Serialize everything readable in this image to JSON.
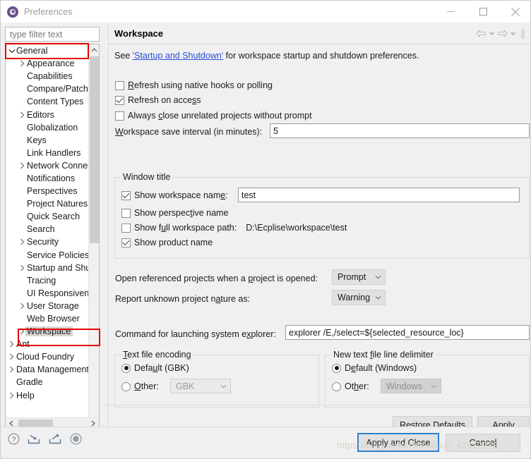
{
  "window": {
    "title": "Preferences",
    "icon": "preferences-gear-icon",
    "minimize_label": "Minimize",
    "maximize_label": "Maximize",
    "close_label": "Close"
  },
  "sidebar": {
    "filter": {
      "value": "",
      "placeholder": "type filter text"
    },
    "items": [
      {
        "label": "General",
        "indent": 0,
        "expander": "down",
        "selected": false,
        "highlighted": true
      },
      {
        "label": "Appearance",
        "indent": 1,
        "expander": "right",
        "selected": false
      },
      {
        "label": "Capabilities",
        "indent": 1,
        "expander": "none",
        "selected": false
      },
      {
        "label": "Compare/Patch",
        "indent": 1,
        "expander": "none",
        "selected": false
      },
      {
        "label": "Content Types",
        "indent": 1,
        "expander": "none",
        "selected": false
      },
      {
        "label": "Editors",
        "indent": 1,
        "expander": "right",
        "selected": false
      },
      {
        "label": "Globalization",
        "indent": 1,
        "expander": "none",
        "selected": false
      },
      {
        "label": "Keys",
        "indent": 1,
        "expander": "none",
        "selected": false
      },
      {
        "label": "Link Handlers",
        "indent": 1,
        "expander": "none",
        "selected": false
      },
      {
        "label": "Network Connections",
        "indent": 1,
        "expander": "right",
        "selected": false
      },
      {
        "label": "Notifications",
        "indent": 1,
        "expander": "none",
        "selected": false
      },
      {
        "label": "Perspectives",
        "indent": 1,
        "expander": "none",
        "selected": false
      },
      {
        "label": "Project Natures",
        "indent": 1,
        "expander": "none",
        "selected": false
      },
      {
        "label": "Quick Search",
        "indent": 1,
        "expander": "none",
        "selected": false
      },
      {
        "label": "Search",
        "indent": 1,
        "expander": "none",
        "selected": false
      },
      {
        "label": "Security",
        "indent": 1,
        "expander": "right",
        "selected": false
      },
      {
        "label": "Service Policies",
        "indent": 1,
        "expander": "none",
        "selected": false
      },
      {
        "label": "Startup and Shutdown",
        "indent": 1,
        "expander": "right",
        "selected": false
      },
      {
        "label": "Tracing",
        "indent": 1,
        "expander": "none",
        "selected": false
      },
      {
        "label": "UI Responsiveness",
        "indent": 1,
        "expander": "none",
        "selected": false
      },
      {
        "label": "User Storage",
        "indent": 1,
        "expander": "right",
        "selected": false
      },
      {
        "label": "Web Browser",
        "indent": 1,
        "expander": "none",
        "selected": false
      },
      {
        "label": "Workspace",
        "indent": 1,
        "expander": "right",
        "selected": true,
        "highlighted": true
      },
      {
        "label": "Ant",
        "indent": 0,
        "expander": "right",
        "selected": false
      },
      {
        "label": "Cloud Foundry",
        "indent": 0,
        "expander": "right",
        "selected": false
      },
      {
        "label": "Data Management",
        "indent": 0,
        "expander": "right",
        "selected": false
      },
      {
        "label": "Gradle",
        "indent": 0,
        "expander": "none",
        "selected": false
      },
      {
        "label": "Help",
        "indent": 0,
        "expander": "right",
        "selected": false
      }
    ]
  },
  "page": {
    "title": "Workspace",
    "toolbar": {
      "back": "back-arrow",
      "back_menu": "back-dropdown",
      "forward": "forward-arrow",
      "forward_menu": "forward-dropdown",
      "more": "view-menu"
    },
    "intro": {
      "prefix": "See ",
      "link": "'Startup and Shutdown'",
      "suffix": " for workspace startup and shutdown preferences."
    },
    "checkboxes": [
      {
        "label": "Refresh using native hooks or polling",
        "checked": false,
        "mnemonic": "R"
      },
      {
        "label": "Refresh on access",
        "checked": true,
        "mnemonic": "s"
      },
      {
        "label": "Always close unrelated projects without prompt",
        "checked": false,
        "mnemonic": "c"
      }
    ],
    "save_interval": {
      "label": "Workspace save interval (in minutes):",
      "value": "5"
    },
    "window_title_group": {
      "title": "Window title",
      "show_workspace_name": {
        "label": "Show workspace name:",
        "checked": true,
        "value": "test"
      },
      "show_perspective_name": {
        "label": "Show perspective name",
        "checked": false
      },
      "show_full_workspace_path": {
        "label": "Show full workspace path:",
        "checked": false,
        "value": "D:\\Ecplise\\workspace\\test"
      },
      "show_product_name": {
        "label": "Show product name",
        "checked": true
      }
    },
    "open_referenced": {
      "label": "Open referenced projects when a project is opened:",
      "value": "Prompt"
    },
    "report_nature": {
      "label": "Report unknown project nature as:",
      "value": "Warning"
    },
    "explorer_command": {
      "label": "Command for launching system explorer:",
      "value": "explorer /E,/select=${selected_resource_loc}"
    },
    "text_file_encoding": {
      "title": "Text file encoding",
      "default_label": "Default (GBK)",
      "default_selected": true,
      "other_label": "Other:",
      "other_selected": false,
      "other_value": "GBK"
    },
    "line_delimiter": {
      "title": "New text file line delimiter",
      "default_label": "Default (Windows)",
      "default_selected": true,
      "other_label": "Other:",
      "other_selected": false,
      "other_value": "Windows"
    },
    "restore_defaults_label": "Restore Defaults",
    "apply_label": "Apply"
  },
  "footer": {
    "icons": [
      "help-icon",
      "import-icon",
      "export-icon",
      "record-icon"
    ],
    "apply_and_close_label": "Apply and Close",
    "cancel_label": "Cancel"
  },
  "watermark": "https://blog.csdn.net/weixin_42412272",
  "colors": {
    "dialog_bg": "#f0f0f0",
    "accent_link": "#2a4fd6",
    "highlight_red": "#e60000",
    "default_button_border": "#2f7fd0",
    "selection_gray": "#d6d6d6"
  }
}
